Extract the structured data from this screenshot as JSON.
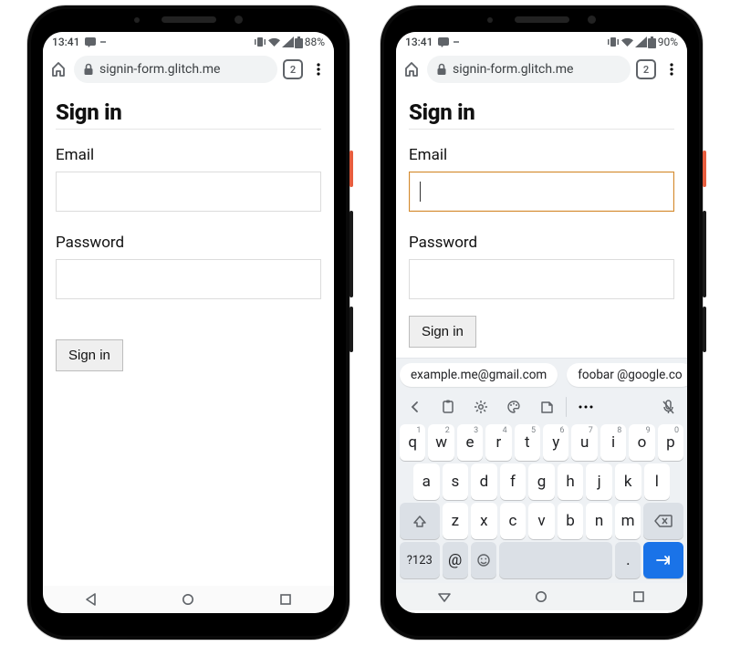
{
  "phones": [
    {
      "status": {
        "time": "13:41",
        "battery": "88%"
      },
      "address": {
        "url_text": "signin-form.glitch.me",
        "tab_count": "2"
      },
      "page": {
        "heading": "Sign in",
        "email_label": "Email",
        "password_label": "Password",
        "submit_label": "Sign in",
        "email_value": "",
        "password_value": ""
      }
    },
    {
      "status": {
        "time": "13:41",
        "battery": "90%"
      },
      "address": {
        "url_text": "signin-form.glitch.me",
        "tab_count": "2"
      },
      "page": {
        "heading": "Sign in",
        "email_label": "Email",
        "password_label": "Password",
        "submit_label": "Sign in",
        "email_value": "",
        "password_value": ""
      },
      "suggestions": [
        "example.me@gmail.com",
        "foobar @google.co"
      ],
      "keyboard": {
        "row1": [
          {
            "k": "q",
            "n": "1"
          },
          {
            "k": "w",
            "n": "2"
          },
          {
            "k": "e",
            "n": "3"
          },
          {
            "k": "r",
            "n": "4"
          },
          {
            "k": "t",
            "n": "5"
          },
          {
            "k": "y",
            "n": "6"
          },
          {
            "k": "u",
            "n": "7"
          },
          {
            "k": "i",
            "n": "8"
          },
          {
            "k": "o",
            "n": "9"
          },
          {
            "k": "p",
            "n": "0"
          }
        ],
        "row2": [
          "a",
          "s",
          "d",
          "f",
          "g",
          "h",
          "j",
          "k",
          "l"
        ],
        "row3": [
          "z",
          "x",
          "c",
          "v",
          "b",
          "n",
          "m"
        ],
        "row4": {
          "sym": "?123",
          "at": "@",
          "period": "."
        }
      }
    }
  ]
}
